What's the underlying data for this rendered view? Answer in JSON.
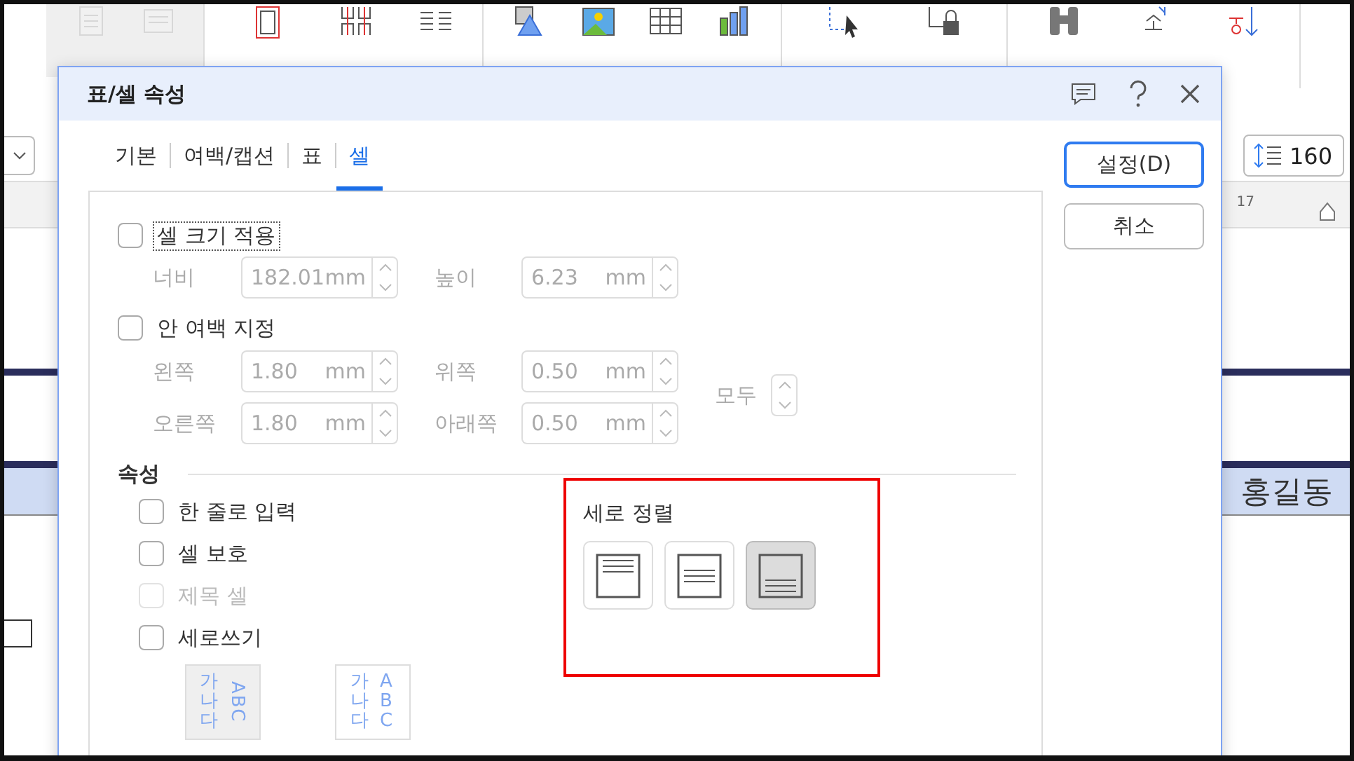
{
  "toolbar": {
    "groups": [
      {
        "panel": true,
        "items": [
          {
            "disabled": true
          },
          {
            "disabled": true
          }
        ]
      },
      {
        "panel": false,
        "items": [
          {
            "disabled": false
          },
          {
            "disabled": false
          },
          {
            "disabled": false
          }
        ]
      },
      {
        "panel": false,
        "items": [
          {
            "disabled": false
          },
          {
            "disabled": false
          },
          {
            "disabled": false
          },
          {
            "disabled": false
          }
        ]
      },
      {
        "panel": false,
        "items": [
          {
            "disabled": false
          },
          {
            "disabled": false
          }
        ]
      },
      {
        "panel": false,
        "items": [
          {
            "disabled": false
          },
          {
            "disabled": false
          },
          {
            "disabled": false
          }
        ]
      }
    ]
  },
  "format_bar": {
    "line_spacing": "160"
  },
  "ruler": {
    "mark": "17"
  },
  "document": {
    "name_cell": "홍길동"
  },
  "dialog": {
    "title": "표/셀 속성",
    "tabs": [
      {
        "label": "기본",
        "selected": false
      },
      {
        "label": "여백/캡션",
        "selected": false
      },
      {
        "label": "표",
        "selected": false
      },
      {
        "label": "셀",
        "selected": true
      }
    ],
    "buttons": [
      {
        "label": "설정(D)",
        "default": true
      },
      {
        "label": "취소",
        "default": false
      }
    ],
    "cell_size": {
      "label": "셀 크기 적용",
      "checked": false,
      "focused": true,
      "fields": [
        {
          "label": "너비",
          "value": "182.01",
          "unit": "mm",
          "disabled": true
        },
        {
          "label": "높이",
          "value": "6.23",
          "unit": "mm",
          "disabled": true
        }
      ]
    },
    "inner_margin": {
      "label": "안 여백 지정",
      "checked": false,
      "focused": false,
      "fields": [
        {
          "label": "왼쪽",
          "value": "1.80",
          "unit": "mm",
          "disabled": true
        },
        {
          "label": "위쪽",
          "value": "0.50",
          "unit": "mm",
          "disabled": true
        },
        {
          "label": "오른쪽",
          "value": "1.80",
          "unit": "mm",
          "disabled": true
        },
        {
          "label": "아래쪽",
          "value": "0.50",
          "unit": "mm",
          "disabled": true
        }
      ],
      "all": {
        "label": "모두",
        "disabled": true
      }
    },
    "properties": {
      "title": "속성",
      "options": [
        {
          "label": "한 줄로 입력",
          "checked": false,
          "disabled": false
        },
        {
          "label": "셀 보호",
          "checked": false,
          "disabled": false
        },
        {
          "label": "제목 셀",
          "checked": false,
          "disabled": true
        },
        {
          "label": "세로쓰기",
          "checked": false,
          "disabled": false
        }
      ],
      "latin_modes": [
        {
          "kind": "rotated",
          "hangul": "가나다",
          "latin": "ABC",
          "selected": true
        },
        {
          "kind": "upright",
          "hangul": "가나다",
          "latin": "ABC",
          "selected": false
        }
      ]
    },
    "vertical_align": {
      "title": "세로 정렬",
      "highlighted": true,
      "options": [
        {
          "kind": "top",
          "selected": false
        },
        {
          "kind": "middle",
          "selected": false
        },
        {
          "kind": "bottom",
          "selected": true
        }
      ]
    }
  }
}
